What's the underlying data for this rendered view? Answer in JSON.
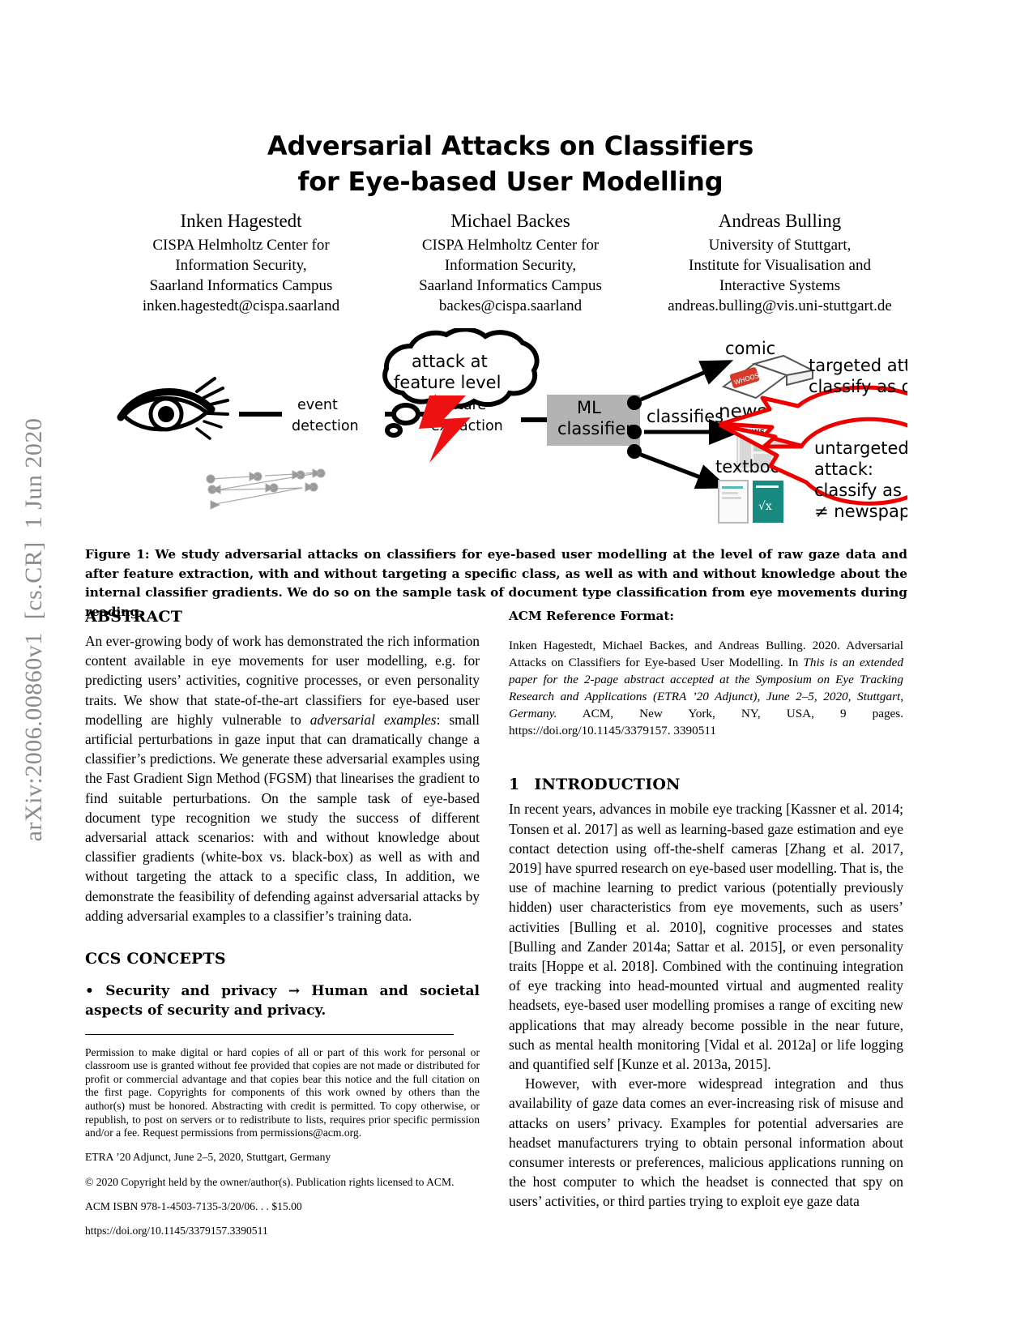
{
  "arxiv_stamp": "arXiv:2006.00860v1  [cs.CR]  1 Jun 2020",
  "title": {
    "line1": "Adversarial Attacks on Classifiers",
    "line2": "for Eye-based User Modelling"
  },
  "authors": [
    {
      "name": "Inken Hagestedt",
      "affiliation_lines": [
        "CISPA Helmholtz Center for",
        "Information Security,",
        "Saarland Informatics Campus",
        "inken.hagestedt@cispa.saarland"
      ]
    },
    {
      "name": "Michael Backes",
      "affiliation_lines": [
        "CISPA Helmholtz Center for",
        "Information Security,",
        "Saarland Informatics Campus",
        "backes@cispa.saarland"
      ]
    },
    {
      "name": "Andreas Bulling",
      "affiliation_lines": [
        "University of Stuttgart,",
        "Institute for Visualisation and",
        "Interactive Systems",
        "andreas.bulling@vis.uni-stuttgart.de"
      ]
    }
  ],
  "figure": {
    "pipeline": [
      "event detection",
      "feature extraction",
      "ML classifier",
      "classifies"
    ],
    "stage_labels": {
      "event_detection_l1": "event",
      "event_detection_l2": "detection",
      "feature_extraction_l1": "feature",
      "feature_extraction_l2": "extraction",
      "classifier_l1": "ML",
      "classifier_l2": "classifier",
      "classifies": "classifies"
    },
    "cloud": {
      "line1": "attack at",
      "line2": "feature level"
    },
    "classes": [
      "comic",
      "newspaper",
      "textbook"
    ],
    "bubbles": [
      {
        "lines": [
          "targeted attack:",
          "classify as comic"
        ]
      },
      {
        "lines": [
          "untargeted",
          "attack:",
          "classify as",
          "≠ newspaper"
        ]
      }
    ],
    "colors": {
      "bolt": "#ee1111",
      "bubble_stroke": "#ee0000",
      "classifier_box": "#b3b3b3",
      "gaze_trace": "#999999"
    },
    "caption": "Figure 1: We study adversarial attacks on classifiers for eye-based user modelling at the level of raw gaze data and after feature extraction, with and without targeting a specific class, as well as with and without knowledge about the internal classifier gradients. We do so on the sample task of document type classification from eye movements during reading."
  },
  "abstract": {
    "heading": "ABSTRACT",
    "part1": "An ever-growing body of work has demonstrated the rich information content available in eye movements for user modelling, e.g. for predicting users’ activities, cognitive processes, or even personality traits. We show that state-of-the-art classifiers for eye-based user modelling are highly vulnerable to ",
    "italic1": "adversarial examples",
    "part2": ": small artificial perturbations in gaze input that can dramatically change a classifier’s predictions. We generate these adversarial examples using the Fast Gradient Sign Method (FGSM) that linearises the gradient to find suitable perturbations. On the sample task of eye-based document type recognition we study the success of different adversarial attack scenarios: with and without knowledge about classifier gradients (white-box vs. black-box) as well as with and without targeting the attack to a specific class, In addition, we demonstrate the feasibility of defending against adversarial attacks by adding adversarial examples to a classifier’s training data."
  },
  "ccs": {
    "heading": "CCS CONCEPTS",
    "text_bold": "• Security and privacy → Human and societal aspects of security and privacy",
    "text_tail": "."
  },
  "permission": {
    "paragraph": "Permission to make digital or hard copies of all or part of this work for personal or classroom use is granted without fee provided that copies are not made or distributed for profit or commercial advantage and that copies bear this notice and the full citation on the first page. Copyrights for components of this work owned by others than the author(s) must be honored. Abstracting with credit is permitted. To copy otherwise, or republish, to post on servers or to redistribute to lists, requires prior specific permission and/or a fee. Request permissions from permissions@acm.org.",
    "venue_italic": "ETRA ’20 Adjunct, June 2–5, 2020, Stuttgart, Germany",
    "copyright": "© 2020 Copyright held by the owner/author(s). Publication rights licensed to ACM.",
    "isbn": "ACM ISBN 978-1-4503-7135-3/20/06. . . $15.00",
    "doi": "https://doi.org/10.1145/3379157.3390511"
  },
  "acm_reference": {
    "heading": "ACM Reference Format:",
    "part1": "Inken Hagestedt, Michael Backes, and Andreas Bulling. 2020. Adversarial Attacks on Classifiers for Eye-based User Modelling. In ",
    "italic": "This is an extended paper for the 2-page abstract accepted at the Symposium on Eye Tracking Research and Applications (ETRA ’20 Adjunct), June 2–5, 2020, Stuttgart, Germany.",
    "part2": " ACM, New York, NY, USA, 9 pages. https://doi.org/10.1145/3379157. 3390511"
  },
  "introduction": {
    "number": "1",
    "heading": "INTRODUCTION",
    "para1": "In recent years, advances in mobile eye tracking [Kassner et al. 2014; Tonsen et al. 2017] as well as learning-based gaze estimation and eye contact detection using off-the-shelf cameras [Zhang et al. 2017, 2019] have spurred research on eye-based user modelling. That is, the use of machine learning to predict various (potentially previously hidden) user characteristics from eye movements, such as users’ activities [Bulling et al. 2010], cognitive processes and states [Bulling and Zander 2014a; Sattar et al. 2015], or even personality traits [Hoppe et al. 2018]. Combined with the continuing integration of eye tracking into head-mounted virtual and augmented reality headsets, eye-based user modelling promises a range of exciting new applications that may already become possible in the near future, such as mental health monitoring [Vidal et al. 2012a] or life logging and quantified self [Kunze et al. 2013a, 2015].",
    "para2": "However, with ever-more widespread integration and thus availability of gaze data comes an ever-increasing risk of misuse and attacks on users’ privacy. Examples for potential adversaries are headset manufacturers trying to obtain personal information about consumer interests or preferences, malicious applications running on the host computer to which the headset is connected that spy on users’ activities, or third parties trying to exploit eye gaze data"
  }
}
